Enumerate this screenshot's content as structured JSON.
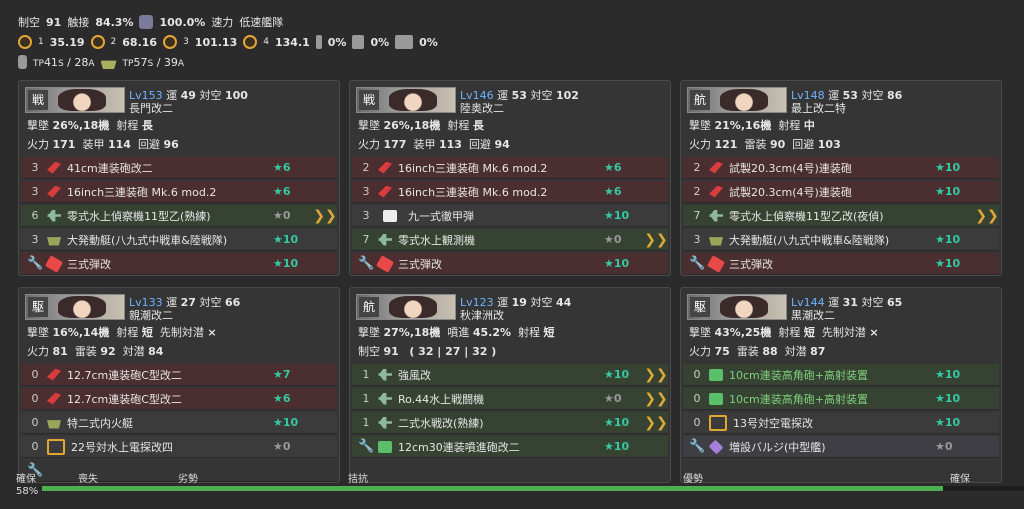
{
  "summary": {
    "air_label": "制空",
    "air_value": "91",
    "contact_label": "触接",
    "contact_value": "84.3%",
    "radar_value": "100.0%",
    "speed_label": "速力",
    "speed_value": "低速艦隊",
    "los": [
      {
        "sub": "1",
        "value": "35.19"
      },
      {
        "sub": "2",
        "value": "68.16"
      },
      {
        "sub": "3",
        "value": "101.13"
      },
      {
        "sub": "4",
        "value": "134.1"
      }
    ],
    "smoke": [
      "0%",
      "0%",
      "0%"
    ],
    "tp_drum_main": "41",
    "tp_drum_s": "S",
    "tp_drum_sep": "/ 28",
    "tp_drum_a": "A",
    "tp_boat_main": "57",
    "tp_boat_s": "S",
    "tp_boat_sep": "/ 39",
    "tp_boat_a": "A",
    "tp_label": "TP"
  },
  "ships": [
    {
      "kanji": "戦",
      "lv": "Lv153",
      "luck_label": "運",
      "luck": "49",
      "asw_label": "対空",
      "asw": "100",
      "name": "長門改二",
      "row2": [
        [
          "撃墜",
          "26%,18機"
        ],
        [
          "射程",
          "長"
        ]
      ],
      "row3": [
        [
          "火力",
          "171"
        ],
        [
          "装甲",
          "114"
        ],
        [
          "回避",
          "96"
        ]
      ],
      "equips": [
        {
          "count": "3",
          "name": "41cm連装砲改二",
          "star": "★6",
          "icon": "gun",
          "bg": "red"
        },
        {
          "count": "3",
          "name": "16inch三連装砲 Mk.6 mod.2",
          "star": "★6",
          "icon": "gun",
          "bg": "red"
        },
        {
          "count": "6",
          "name": "零式水上偵察機11型乙(熟練)",
          "star": "★0",
          "icon": "plane",
          "bg": "grn",
          "chev": "❯❯"
        },
        {
          "count": "3",
          "name": "大発動艇(八九式中戦車&陸戦隊)",
          "star": "★10",
          "icon": "boat",
          "bg": "gry"
        },
        {
          "count": "🔧",
          "name": "三式弾改",
          "star": "★10",
          "icon": "ammo",
          "bg": "red"
        }
      ]
    },
    {
      "kanji": "戦",
      "lv": "Lv146",
      "luck_label": "運",
      "luck": "53",
      "asw_label": "対空",
      "asw": "102",
      "name": "陸奥改二",
      "row2": [
        [
          "撃墜",
          "26%,18機"
        ],
        [
          "射程",
          "長"
        ]
      ],
      "row3": [
        [
          "火力",
          "177"
        ],
        [
          "装甲",
          "113"
        ],
        [
          "回避",
          "94"
        ]
      ],
      "equips": [
        {
          "count": "2",
          "name": "16inch三連装砲 Mk.6 mod.2",
          "star": "★6",
          "icon": "gun",
          "bg": "red"
        },
        {
          "count": "3",
          "name": "16inch三連装砲 Mk.6 mod.2",
          "star": "★6",
          "icon": "gun",
          "bg": "red"
        },
        {
          "count": "3",
          "name": "九一式徹甲弾",
          "star": "★10",
          "icon": "missile",
          "bg": "gry"
        },
        {
          "count": "7",
          "name": "零式水上観測機",
          "star": "★0",
          "icon": "plane",
          "bg": "grn",
          "chev": "❯❯"
        },
        {
          "count": "🔧",
          "name": "三式弾改",
          "star": "★10",
          "icon": "ammo",
          "bg": "red"
        }
      ]
    },
    {
      "kanji": "航",
      "lv": "Lv148",
      "luck_label": "運",
      "luck": "53",
      "asw_label": "対空",
      "asw": "86",
      "name": "最上改二特",
      "row2": [
        [
          "撃墜",
          "21%,16機"
        ],
        [
          "射程",
          "中"
        ]
      ],
      "row3": [
        [
          "火力",
          "121"
        ],
        [
          "雷装",
          "90"
        ],
        [
          "回避",
          "103"
        ]
      ],
      "equips": [
        {
          "count": "2",
          "name": "試製20.3cm(4号)連装砲",
          "star": "★10",
          "icon": "gun",
          "bg": "red"
        },
        {
          "count": "2",
          "name": "試製20.3cm(4号)連装砲",
          "star": "★10",
          "icon": "gun",
          "bg": "red"
        },
        {
          "count": "7",
          "name": "零式水上偵察機11型乙改(夜偵)",
          "star": "",
          "icon": "plane",
          "bg": "grn",
          "chev": "❯❯"
        },
        {
          "count": "3",
          "name": "大発動艇(八九式中戦車&陸戦隊)",
          "star": "★10",
          "icon": "boat",
          "bg": "gry"
        },
        {
          "count": "🔧",
          "name": "三式弾改",
          "star": "★10",
          "icon": "ammo",
          "bg": "red"
        }
      ]
    },
    {
      "kanji": "駆",
      "lv": "Lv133",
      "luck_label": "運",
      "luck": "27",
      "asw_label": "対空",
      "asw": "66",
      "name": "親潮改二",
      "row2": [
        [
          "撃墜",
          "16%,14機"
        ],
        [
          "射程",
          "短"
        ],
        [
          "先制対潜",
          "×"
        ]
      ],
      "row3": [
        [
          "火力",
          "81"
        ],
        [
          "雷装",
          "92"
        ],
        [
          "対潜",
          "84"
        ]
      ],
      "equips": [
        {
          "count": "0",
          "name": "12.7cm連装砲C型改二",
          "star": "★7",
          "icon": "gun",
          "bg": "red"
        },
        {
          "count": "0",
          "name": "12.7cm連装砲C型改二",
          "star": "★6",
          "icon": "gun",
          "bg": "red"
        },
        {
          "count": "0",
          "name": "特二式内火艇",
          "star": "★10",
          "icon": "boat",
          "bg": "gry"
        },
        {
          "count": "0",
          "name": "22号対水上電探改四",
          "star": "★0",
          "icon": "radar",
          "bg": "gry"
        },
        {
          "count": "🔧",
          "name": "",
          "star": "",
          "icon": "",
          "bg": ""
        }
      ]
    },
    {
      "kanji": "航",
      "lv": "Lv123",
      "luck_label": "運",
      "luck": "19",
      "asw_label": "対空",
      "asw": "44",
      "name": "秋津洲改",
      "row2": [
        [
          "撃墜",
          "27%,18機"
        ],
        [
          "噴進",
          "45.2%"
        ],
        [
          "射程",
          "短"
        ]
      ],
      "row3": [
        [
          "制空",
          "91"
        ],
        [
          "",
          "( 32 | 27 | 32 )"
        ]
      ],
      "equips": [
        {
          "count": "1",
          "name": "強風改",
          "star": "★10",
          "icon": "plane",
          "bg": "grn",
          "chev": "❯❯"
        },
        {
          "count": "1",
          "name": "Ro.44水上戦闘機",
          "star": "★0",
          "icon": "plane",
          "bg": "grn",
          "chev": "❯❯"
        },
        {
          "count": "1",
          "name": "二式水戦改(熟練)",
          "star": "★10",
          "icon": "plane",
          "bg": "grn",
          "chev": "❯❯"
        },
        {
          "count": "🔧",
          "name": "12cm30連装噴進砲改二",
          "star": "★10",
          "icon": "aagun",
          "bg": "grn"
        },
        {
          "count": "",
          "name": "",
          "star": "",
          "icon": "",
          "bg": ""
        }
      ]
    },
    {
      "kanji": "駆",
      "lv": "Lv144",
      "luck_label": "運",
      "luck": "31",
      "asw_label": "対空",
      "asw": "65",
      "name": "黒潮改二",
      "row2": [
        [
          "撃墜",
          "43%,25機"
        ],
        [
          "射程",
          "短"
        ],
        [
          "先制対潜",
          "×"
        ]
      ],
      "row3": [
        [
          "火力",
          "75"
        ],
        [
          "雷装",
          "88"
        ],
        [
          "対潜",
          "87"
        ]
      ],
      "equips": [
        {
          "count": "0",
          "name": "10cm連装高角砲+高射装置",
          "star": "★10",
          "icon": "aagun",
          "bg": "grn",
          "green": true
        },
        {
          "count": "0",
          "name": "10cm連装高角砲+高射装置",
          "star": "★10",
          "icon": "aagun",
          "bg": "grn",
          "green": true
        },
        {
          "count": "0",
          "name": "13号対空電探改",
          "star": "★10",
          "icon": "radar",
          "bg": "gry"
        },
        {
          "count": "🔧",
          "name": "増設バルジ(中型艦)",
          "star": "★0",
          "icon": "bulge",
          "bg": "slt"
        },
        {
          "count": "",
          "name": "",
          "star": "",
          "icon": "",
          "bg": ""
        }
      ]
    }
  ],
  "bottom": {
    "label": "確保",
    "percent": "58%",
    "fill_fraction": 0.915,
    "scale": [
      "喪失",
      "劣勢",
      "拮抗",
      "優勢",
      "確保"
    ]
  }
}
